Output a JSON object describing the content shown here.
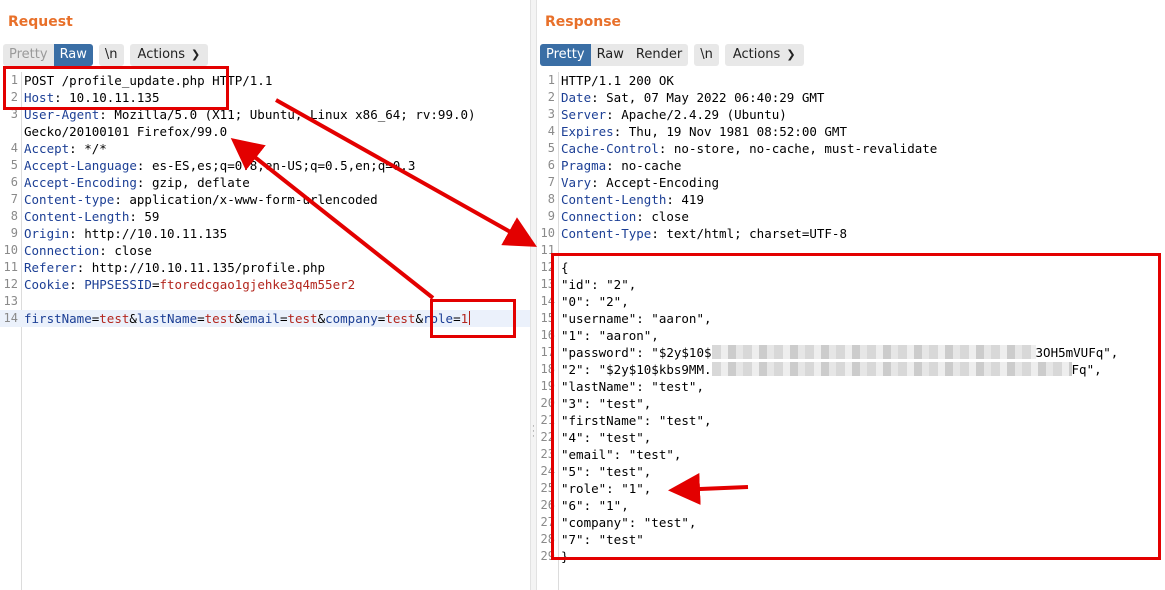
{
  "request": {
    "title": "Request",
    "tabs": [
      "Pretty",
      "Raw",
      "\\n",
      "Actions"
    ],
    "lines": [
      {
        "n": "1",
        "parts": [
          {
            "t": "POST /profile_update.php HTTP/1.1",
            "c": "plain"
          }
        ]
      },
      {
        "n": "2",
        "parts": [
          {
            "t": "Host",
            "c": "hname"
          },
          {
            "t": ": 10.10.11.135",
            "c": "plain"
          }
        ]
      },
      {
        "n": "3",
        "parts": [
          {
            "t": "User-Agent",
            "c": "hname"
          },
          {
            "t": ": Mozilla/5.0 (X11; Ubuntu; Linux x86_64; rv:99.0)",
            "c": "plain"
          }
        ]
      },
      {
        "n": "",
        "parts": [
          {
            "t": "Gecko/20100101 Firefox/99.0",
            "c": "plain"
          }
        ]
      },
      {
        "n": "4",
        "parts": [
          {
            "t": "Accept",
            "c": "hname"
          },
          {
            "t": ": */*",
            "c": "plain"
          }
        ]
      },
      {
        "n": "5",
        "parts": [
          {
            "t": "Accept-Language",
            "c": "hname"
          },
          {
            "t": ": es-ES,es;q=0.8,en-US;q=0.5,en;q=0.3",
            "c": "plain"
          }
        ]
      },
      {
        "n": "6",
        "parts": [
          {
            "t": "Accept-Encoding",
            "c": "hname"
          },
          {
            "t": ": gzip, deflate",
            "c": "plain"
          }
        ]
      },
      {
        "n": "7",
        "parts": [
          {
            "t": "Content-type",
            "c": "hname"
          },
          {
            "t": ": application/x-www-form-urlencoded",
            "c": "plain"
          }
        ]
      },
      {
        "n": "8",
        "parts": [
          {
            "t": "Content-Length",
            "c": "hname"
          },
          {
            "t": ": 59",
            "c": "plain"
          }
        ]
      },
      {
        "n": "9",
        "parts": [
          {
            "t": "Origin",
            "c": "hname"
          },
          {
            "t": ": http://10.10.11.135",
            "c": "plain"
          }
        ]
      },
      {
        "n": "10",
        "parts": [
          {
            "t": "Connection",
            "c": "hname"
          },
          {
            "t": ": close",
            "c": "plain"
          }
        ]
      },
      {
        "n": "11",
        "parts": [
          {
            "t": "Referer",
            "c": "hname"
          },
          {
            "t": ": http://10.10.11.135/profile.php",
            "c": "plain"
          }
        ]
      },
      {
        "n": "12",
        "parts": [
          {
            "t": "Cookie",
            "c": "hname"
          },
          {
            "t": ": ",
            "c": "plain"
          },
          {
            "t": "PHPSESSID",
            "c": "hname"
          },
          {
            "t": "=",
            "c": "plain"
          },
          {
            "t": "ftoredcgao1gjehke3q4m55er2",
            "c": "cookie-val"
          }
        ]
      },
      {
        "n": "13",
        "parts": []
      },
      {
        "n": "14",
        "cursor": true,
        "parts": [
          {
            "t": "firstName",
            "c": "pname"
          },
          {
            "t": "=",
            "c": "pamp"
          },
          {
            "t": "test",
            "c": "pval"
          },
          {
            "t": "&",
            "c": "pamp"
          },
          {
            "t": "lastName",
            "c": "pname"
          },
          {
            "t": "=",
            "c": "pamp"
          },
          {
            "t": "test",
            "c": "pval"
          },
          {
            "t": "&",
            "c": "pamp"
          },
          {
            "t": "email",
            "c": "pname"
          },
          {
            "t": "=",
            "c": "pamp"
          },
          {
            "t": "test",
            "c": "pval"
          },
          {
            "t": "&",
            "c": "pamp"
          },
          {
            "t": "company",
            "c": "pname"
          },
          {
            "t": "=",
            "c": "pamp"
          },
          {
            "t": "test",
            "c": "pval"
          },
          {
            "t": "&",
            "c": "pamp"
          },
          {
            "t": "role",
            "c": "pname"
          },
          {
            "t": "=",
            "c": "pamp"
          },
          {
            "t": "1",
            "c": "pval"
          }
        ]
      }
    ]
  },
  "response": {
    "title": "Response",
    "tabs": [
      "Pretty",
      "Raw",
      "Render",
      "\\n",
      "Actions"
    ],
    "lines": [
      {
        "n": "1",
        "parts": [
          {
            "t": "HTTP/1.1 200 OK",
            "c": "plain"
          }
        ]
      },
      {
        "n": "2",
        "parts": [
          {
            "t": "Date",
            "c": "hname"
          },
          {
            "t": ": Sat, 07 May 2022 06:40:29 GMT",
            "c": "plain"
          }
        ]
      },
      {
        "n": "3",
        "parts": [
          {
            "t": "Server",
            "c": "hname"
          },
          {
            "t": ": Apache/2.4.29 (Ubuntu)",
            "c": "plain"
          }
        ]
      },
      {
        "n": "4",
        "parts": [
          {
            "t": "Expires",
            "c": "hname"
          },
          {
            "t": ": Thu, 19 Nov 1981 08:52:00 GMT",
            "c": "plain"
          }
        ]
      },
      {
        "n": "5",
        "parts": [
          {
            "t": "Cache-Control",
            "c": "hname"
          },
          {
            "t": ": no-store, no-cache, must-revalidate",
            "c": "plain"
          }
        ]
      },
      {
        "n": "6",
        "parts": [
          {
            "t": "Pragma",
            "c": "hname"
          },
          {
            "t": ": no-cache",
            "c": "plain"
          }
        ]
      },
      {
        "n": "7",
        "parts": [
          {
            "t": "Vary",
            "c": "hname"
          },
          {
            "t": ": Accept-Encoding",
            "c": "plain"
          }
        ]
      },
      {
        "n": "8",
        "parts": [
          {
            "t": "Content-Length",
            "c": "hname"
          },
          {
            "t": ": 419",
            "c": "plain"
          }
        ]
      },
      {
        "n": "9",
        "parts": [
          {
            "t": "Connection",
            "c": "hname"
          },
          {
            "t": ": close",
            "c": "plain"
          }
        ]
      },
      {
        "n": "10",
        "parts": [
          {
            "t": "Content-Type",
            "c": "hname"
          },
          {
            "t": ": text/html; charset=UTF-8",
            "c": "plain"
          }
        ]
      },
      {
        "n": "11",
        "parts": []
      },
      {
        "n": "12",
        "parts": [
          {
            "t": "{",
            "c": "plain"
          }
        ]
      },
      {
        "n": "13",
        "parts": [
          {
            "t": "\"id\": \"2\",",
            "c": "plain"
          }
        ]
      },
      {
        "n": "14",
        "parts": [
          {
            "t": "\"0\": \"2\",",
            "c": "plain"
          }
        ]
      },
      {
        "n": "15",
        "parts": [
          {
            "t": "\"username\": \"aaron\",",
            "c": "plain"
          }
        ]
      },
      {
        "n": "16",
        "parts": [
          {
            "t": "\"1\": \"aaron\",",
            "c": "plain"
          }
        ]
      },
      {
        "n": "17",
        "parts": [
          {
            "t": "\"password\": \"$2y$10$",
            "c": "plain"
          },
          {
            "t": "",
            "c": "redact",
            "w": 9
          },
          {
            "t": "3OH5mVUFq\",",
            "c": "plain"
          }
        ]
      },
      {
        "n": "18",
        "parts": [
          {
            "t": "\"2\": \"$2y$10$kbs9MM.",
            "c": "plain"
          },
          {
            "t": "",
            "c": "redact",
            "w": 10
          },
          {
            "t": "Fq\",",
            "c": "plain"
          }
        ]
      },
      {
        "n": "19",
        "parts": [
          {
            "t": "\"lastName\": \"test\",",
            "c": "plain"
          }
        ]
      },
      {
        "n": "20",
        "parts": [
          {
            "t": "\"3\": \"test\",",
            "c": "plain"
          }
        ]
      },
      {
        "n": "21",
        "parts": [
          {
            "t": "\"firstName\": \"test\",",
            "c": "plain"
          }
        ]
      },
      {
        "n": "22",
        "parts": [
          {
            "t": "\"4\": \"test\",",
            "c": "plain"
          }
        ]
      },
      {
        "n": "23",
        "parts": [
          {
            "t": "\"email\": \"test\",",
            "c": "plain"
          }
        ]
      },
      {
        "n": "24",
        "parts": [
          {
            "t": "\"5\": \"test\",",
            "c": "plain"
          }
        ]
      },
      {
        "n": "25",
        "parts": [
          {
            "t": "\"role\": \"1\",",
            "c": "plain"
          }
        ]
      },
      {
        "n": "26",
        "parts": [
          {
            "t": "\"6\": \"1\",",
            "c": "plain"
          }
        ]
      },
      {
        "n": "27",
        "parts": [
          {
            "t": "\"company\": \"test\",",
            "c": "plain"
          }
        ]
      },
      {
        "n": "28",
        "parts": [
          {
            "t": "\"7\": \"test\"",
            "c": "plain"
          }
        ]
      },
      {
        "n": "29",
        "parts": [
          {
            "t": "}",
            "c": "plain"
          }
        ]
      }
    ]
  },
  "colors": {
    "title_orange": "#e8702a",
    "active_tab": "#3a6ea5",
    "header_name": "#1c3f95",
    "param_value": "#b3261e",
    "annotation_red": "#e30000"
  }
}
